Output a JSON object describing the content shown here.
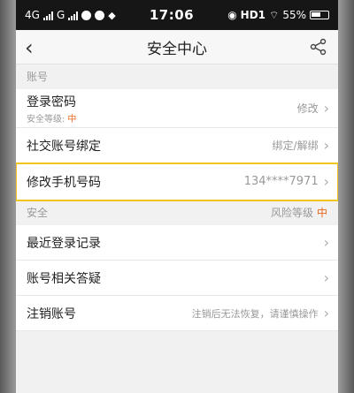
{
  "status": {
    "network_left": "4G",
    "network_mid": "G",
    "time": "17:06",
    "hd": "HD1",
    "battery": "55%"
  },
  "header": {
    "title": "安全中心"
  },
  "sections": {
    "account_label": "账号",
    "security_label": "安全",
    "risk_label": "风险等级",
    "risk_value": "中"
  },
  "account_items": [
    {
      "label": "登录密码",
      "sub_label": "安全等级:",
      "sub_value": "中",
      "right": "修改"
    },
    {
      "label": "社交账号绑定",
      "right": "绑定/解绑"
    },
    {
      "label": "修改手机号码",
      "right": "134****7971"
    }
  ],
  "security_items": [
    {
      "label": "最近登录记录",
      "right": ""
    },
    {
      "label": "账号相关答疑",
      "right": ""
    },
    {
      "label": "注销账号",
      "right": "注销后无法恢复，请谨慎操作"
    }
  ]
}
